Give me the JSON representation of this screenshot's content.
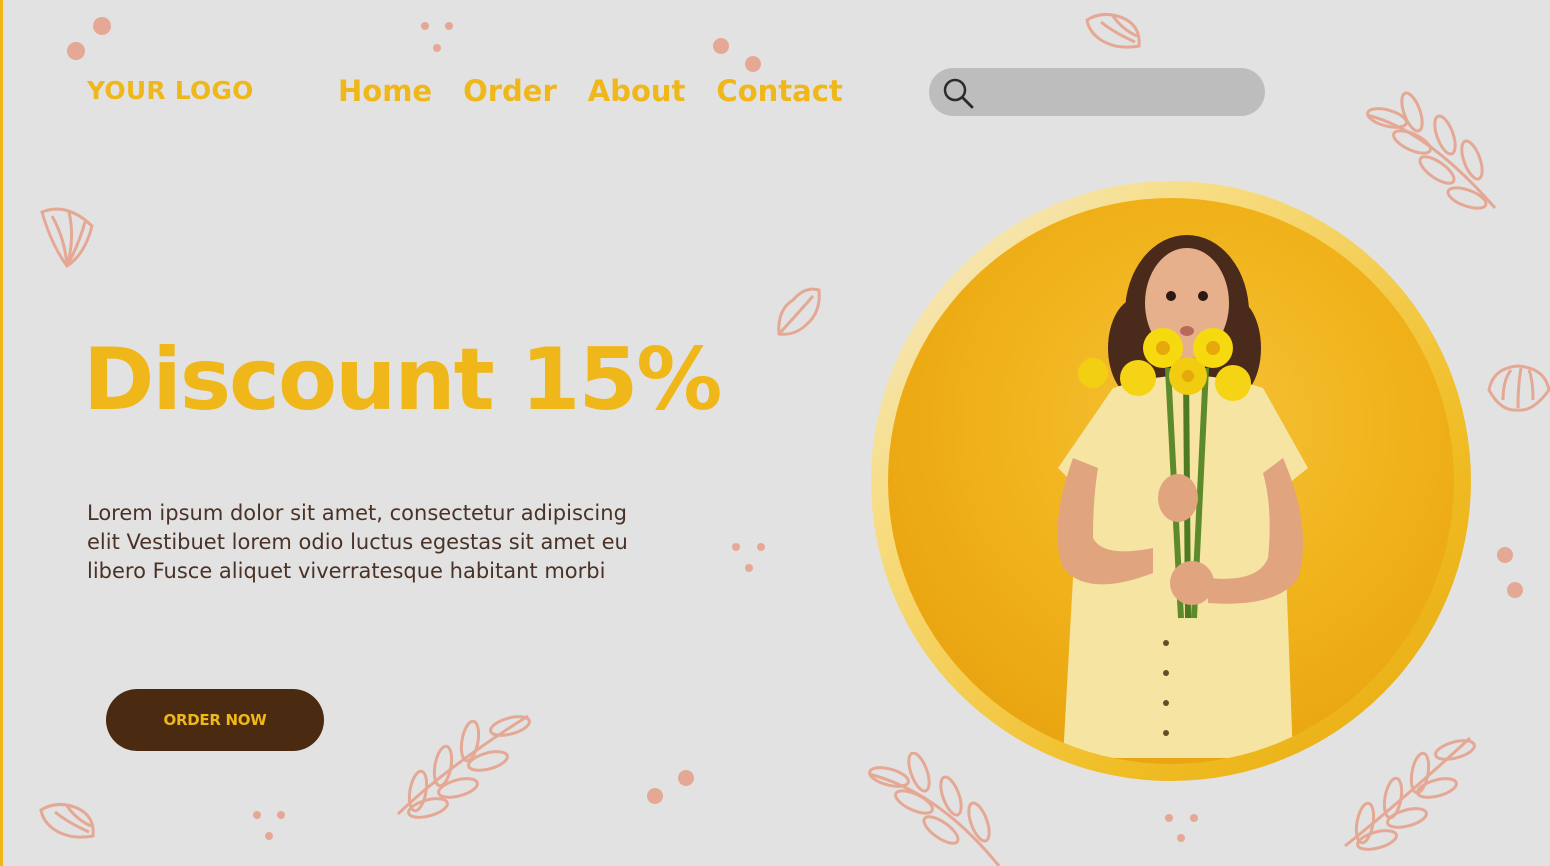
{
  "header": {
    "logo": "YOUR LOGO",
    "nav": [
      {
        "label": "Home"
      },
      {
        "label": "Order"
      },
      {
        "label": "About"
      },
      {
        "label": "Contact"
      }
    ],
    "search": {
      "placeholder": "",
      "value": "",
      "icon": "search-icon"
    }
  },
  "hero": {
    "headline": "Discount 15%",
    "description": "Lorem ipsum dolor sit amet, consectetur adipiscing elit Vestibuet lorem odio luctus egestas sit amet eu libero Fusce aliquet viverratesque habitant morbi",
    "cta_label": "ORDER NOW",
    "image": "woman-with-yellow-daffodils"
  },
  "colors": {
    "background": "#e2e2e2",
    "accent": "#f0b71a",
    "button": "#4a2a10",
    "text": "#4a3226",
    "decoration": "#e4a894"
  }
}
